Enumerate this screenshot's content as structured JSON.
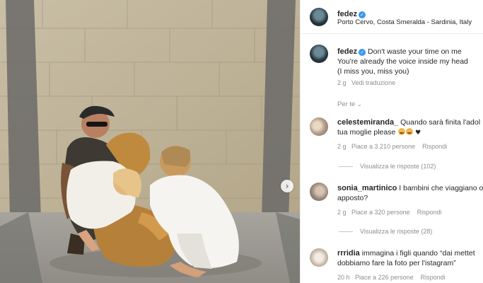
{
  "post": {
    "username": "fedez",
    "location": "Porto Cervo, Costa Smeralda - Sardinia, Italy",
    "caption_line1": "Don't waste your time on me",
    "caption_line2": "You're already the voice inside my head",
    "caption_line3": "(I miss you, miss you)",
    "time": "2 g",
    "translate": "Vedi traduzione",
    "for_you": "Per te",
    "next_icon": "chevron-right"
  },
  "comments": [
    {
      "username": "celestemiranda_",
      "line1": "Quando sarà finita l'adol",
      "line2": "tua moglie please",
      "time": "2 g",
      "likes": "Piace a 3.210 persone",
      "reply": "Rispondi",
      "view_replies": "Visualizza le risposte (102)"
    },
    {
      "username": "sonia_martinico",
      "line1": "I bambini che viaggiano o",
      "line2": "apposto?",
      "time": "2 g",
      "likes": "Piace a 320 persone",
      "reply": "Rispondi",
      "view_replies": "Visualizza le risposte (28)"
    },
    {
      "username": "rrridia",
      "line1": "immagina i figli quando “dai mettet",
      "line2": "dobbiamo fare la foto per l'istagram”",
      "time": "20 h",
      "likes": "Piace a 226 persone",
      "reply": "Rispondi"
    }
  ],
  "colors": {
    "verified": "#3897f0",
    "muted": "#8e8e8e",
    "text": "#262626"
  }
}
